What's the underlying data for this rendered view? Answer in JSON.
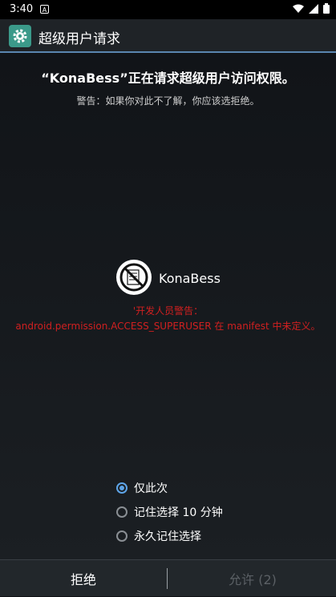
{
  "status_bar": {
    "time": "3:40",
    "notification_icon": "a-icon"
  },
  "app_bar": {
    "title": "超级用户请求",
    "icon": "gear-icon"
  },
  "request": {
    "title": "“KonaBess”正在请求超级用户访问权限。",
    "warning": "警告：如果你对此不了解，你应该选拒绝。"
  },
  "app": {
    "name": "KonaBess",
    "logo_icon": "no-symbol-icon"
  },
  "dev_warning": {
    "line1": "'开发人员警告：",
    "line2": "android.permission.ACCESS_SUPERUSER 在 manifest 中未定义。"
  },
  "options": [
    {
      "label": "仅此次",
      "checked": true
    },
    {
      "label": "记住选择 10 分钟",
      "checked": false
    },
    {
      "label": "永久记住选择",
      "checked": false
    }
  ],
  "buttons": {
    "deny": "拒绝",
    "allow": "允许 (2)"
  },
  "colors": {
    "accent": "#5ea5e8",
    "warning_red": "#d02020",
    "app_bar_bg": "#1f2327"
  }
}
